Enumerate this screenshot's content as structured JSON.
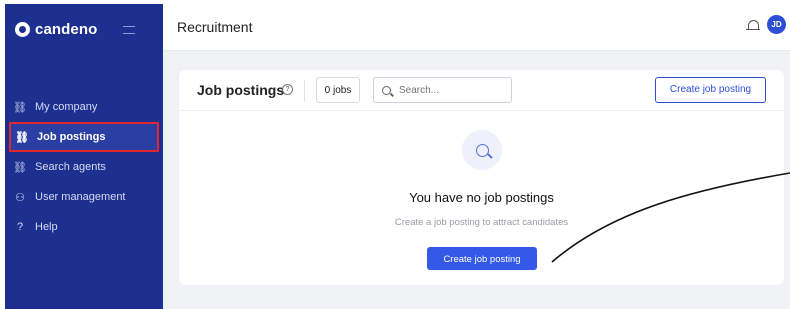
{
  "app": {
    "brand": "candeno",
    "page_title": "Recruitment"
  },
  "sidebar": {
    "items": [
      {
        "label": "My company",
        "icon": "tree-icon"
      },
      {
        "label": "Job postings",
        "icon": "tree-icon"
      },
      {
        "label": "Search agents",
        "icon": "tree-icon"
      },
      {
        "label": "User management",
        "icon": "users-icon"
      },
      {
        "label": "Help",
        "icon": "help-icon"
      }
    ],
    "active_index": 1
  },
  "header": {
    "avatar_initials": "JD"
  },
  "panel": {
    "title": "Job postings",
    "jobs_count": "0 jobs",
    "search_placeholder": "Search...",
    "create_button": "Create job posting"
  },
  "empty_state": {
    "title": "You have no job postings",
    "subtitle": "Create a job posting to attract candidates",
    "button": "Create job posting"
  },
  "colors": {
    "sidebar": "#1d2f8f",
    "accent": "#3458e8",
    "highlight": "#e0262e"
  }
}
